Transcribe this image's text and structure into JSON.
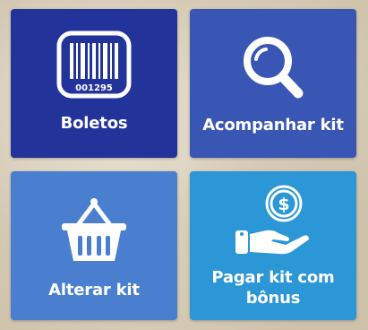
{
  "menu": {
    "boletos": {
      "label": "Boletos",
      "icon": "barcode-icon",
      "barcode_number": "001295",
      "color": "#22349a"
    },
    "acompanhar_kit": {
      "label": "Acompanhar kit",
      "icon": "search-icon",
      "color": "#3a56b5"
    },
    "alterar_kit": {
      "label": "Alterar kit",
      "icon": "basket-icon",
      "color": "#4a7fcf"
    },
    "pagar_kit": {
      "label_line1": "Pagar kit com",
      "label_line2": "bônus",
      "icon": "hand-dollar-icon",
      "coin_symbol": "$",
      "color": "#2b97d6"
    }
  }
}
